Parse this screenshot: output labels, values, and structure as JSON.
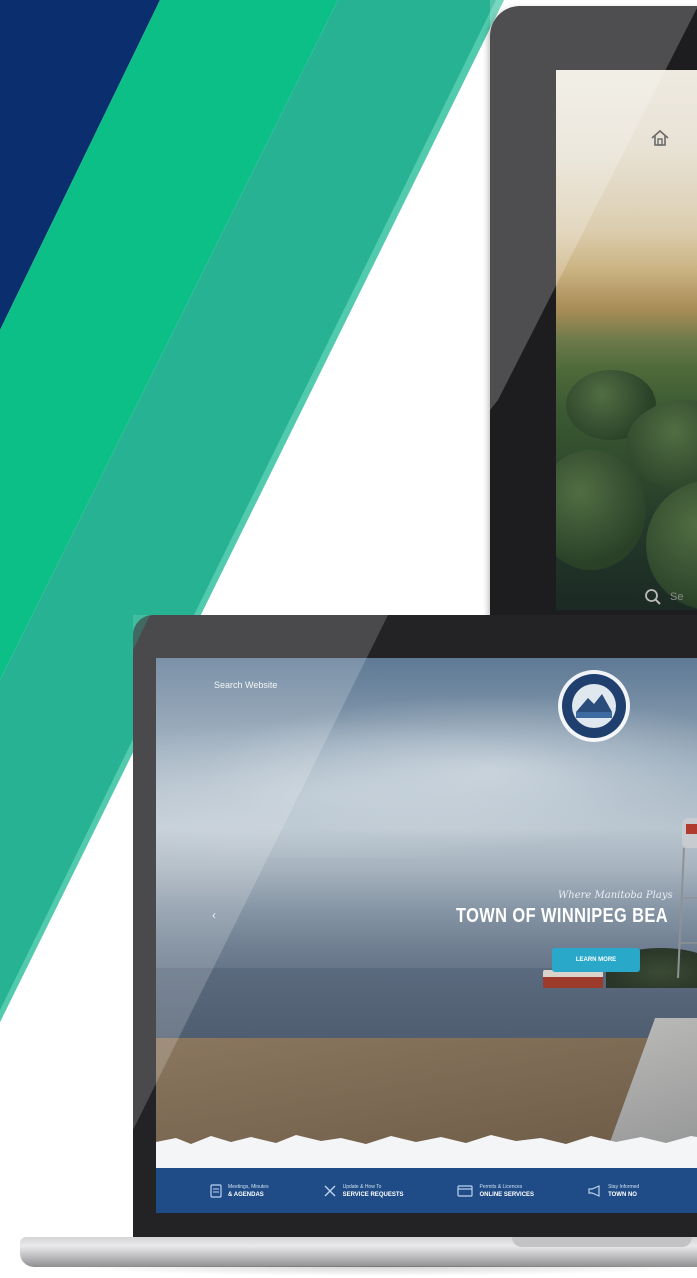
{
  "laptop_site": {
    "search_label": "Search Website",
    "tagline": "Where Manitoba Plays",
    "title": "TOWN OF WINNIPEG BEA",
    "cta_label": "LEARN MORE",
    "nav_items": [
      {
        "icon": "document-icon",
        "small": "Meetings, Minutes",
        "big": "& AGENDAS"
      },
      {
        "icon": "tools-icon",
        "small": "Update & How To",
        "big": "SERVICE REQUESTS"
      },
      {
        "icon": "card-icon",
        "small": "Permits & Licences",
        "big": "ONLINE SERVICES"
      },
      {
        "icon": "megaphone-icon",
        "small": "Stay Informed",
        "big": "TOWN NO"
      }
    ]
  },
  "tablet_site": {
    "search_label": "Se"
  },
  "colors": {
    "navy_stripe": "#0a2e6e",
    "green_stripe": "#0bbf86",
    "teal_stripe": "#27b393",
    "site_nav": "#1f4c86",
    "cta": "#2aa8c9"
  }
}
